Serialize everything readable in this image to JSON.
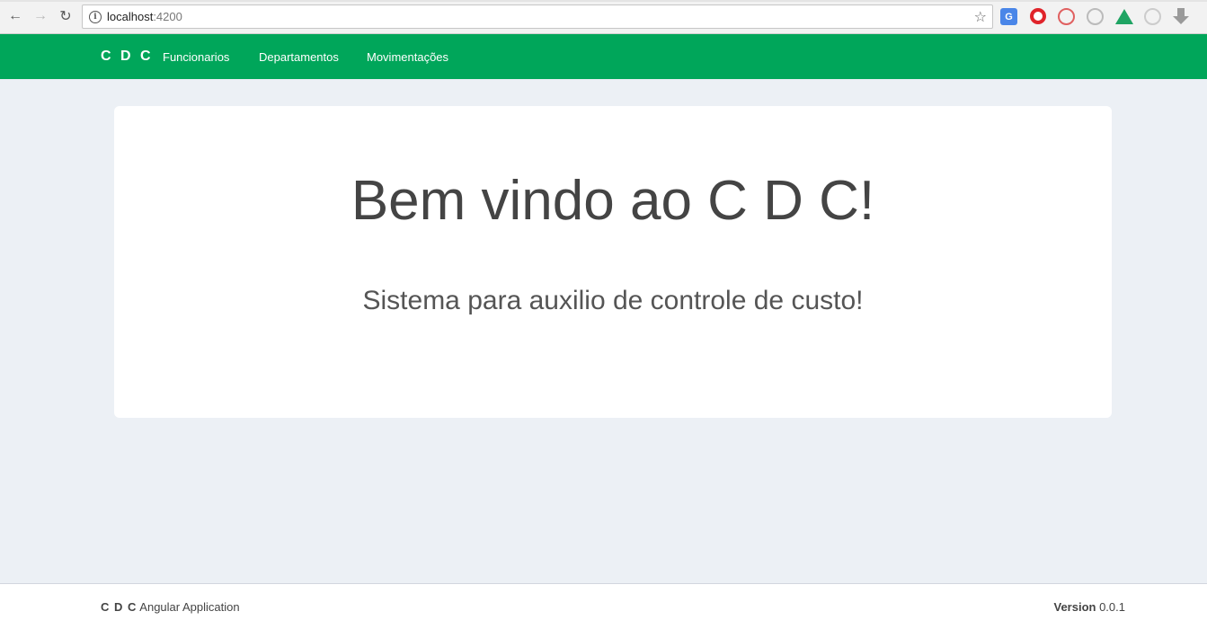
{
  "browser": {
    "url_host": "localhost",
    "url_port": ":4200",
    "icons": [
      "back-icon",
      "forward-icon",
      "reload-icon",
      "info-icon",
      "star-icon"
    ]
  },
  "navbar": {
    "brand": "C D C",
    "links": [
      "Funcionarios",
      "Departamentos",
      "Movimentações"
    ],
    "color": "#00a65a"
  },
  "main": {
    "headline": "Bem vindo ao C D C!",
    "subtitle": "Sistema para auxilio de controle de custo!"
  },
  "footer": {
    "brand": "C D C",
    "app_text": "Angular Application",
    "version_label": "Version",
    "version_value": "0.0.1"
  }
}
